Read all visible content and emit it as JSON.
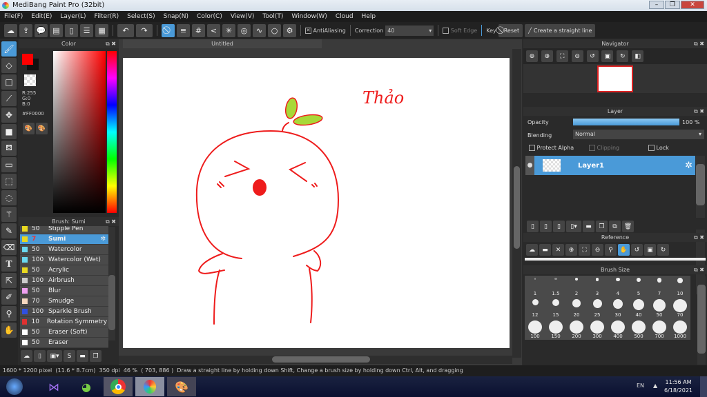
{
  "window": {
    "title": "MediBang Paint Pro (32bit)"
  },
  "menu": [
    "File(F)",
    "Edit(E)",
    "Layer(L)",
    "Filter(R)",
    "Select(S)",
    "Snap(N)",
    "Color(C)",
    "View(V)",
    "Tool(T)",
    "Window(W)",
    "Cloud",
    "Help"
  ],
  "toolbar": {
    "antialiasing": "AntiAliasing",
    "correction_label": "Correction",
    "correction_value": "40",
    "soft_edge": "Soft Edge",
    "key": "Key",
    "reset": "Reset",
    "straight_line": "Create a straight line"
  },
  "color_panel": {
    "title": "Color",
    "r": "R:255",
    "g": "G:0",
    "b": "B:0",
    "hex": "#FF0000",
    "primary": "#FF0000",
    "secondary": "#111111"
  },
  "brush_panel": {
    "title": "Brush: Sumi",
    "items": [
      {
        "size": "50",
        "name": "Stipple Pen",
        "color": "#e8d820"
      },
      {
        "size": "7",
        "name": "Sumi",
        "color": "#e8d820",
        "active": true
      },
      {
        "size": "50",
        "name": "Watercolor",
        "color": "#6ad8f0"
      },
      {
        "size": "100",
        "name": "Watercolor (Wet)",
        "color": "#6ad8f0"
      },
      {
        "size": "50",
        "name": "Acrylic",
        "color": "#e8d820"
      },
      {
        "size": "100",
        "name": "Airbrush",
        "color": "#cccccc"
      },
      {
        "size": "50",
        "name": "Blur",
        "color": "#f0a0f0"
      },
      {
        "size": "70",
        "name": "Smudge",
        "color": "#f5d8c0"
      },
      {
        "size": "100",
        "name": "Sparkle Brush",
        "color": "#3050e0"
      },
      {
        "size": "10",
        "name": "Rotation Symmetry P",
        "color": "#e03030"
      },
      {
        "size": "50",
        "name": "Eraser (Soft)",
        "color": "#ffffff"
      },
      {
        "size": "50",
        "name": "Eraser",
        "color": "#ffffff"
      }
    ]
  },
  "canvas": {
    "tab": "Untitled",
    "signature": "Thảo",
    "stroke_color": "#ee1c1c",
    "leaf_color": "#a8d838"
  },
  "navigator": {
    "title": "Navigator"
  },
  "layer_panel": {
    "title": "Layer",
    "opacity_label": "Opacity",
    "opacity_value": "100 %",
    "opacity": 100,
    "blending_label": "Blending",
    "blending_value": "Normal",
    "protect_alpha": "Protect Alpha",
    "clipping": "Clipping",
    "lock": "Lock",
    "layers": [
      {
        "name": "Layer1"
      }
    ]
  },
  "reference": {
    "title": "Reference"
  },
  "brush_size": {
    "title": "Brush Size",
    "sizes": [
      "1",
      "1.5",
      "2",
      "3",
      "4",
      "5",
      "7",
      "10",
      "12",
      "15",
      "20",
      "25",
      "30",
      "40",
      "50",
      "70",
      "100",
      "150",
      "200",
      "300",
      "400",
      "500",
      "700",
      "1000"
    ]
  },
  "status": {
    "size": "1600 * 1200 pixel",
    "cm": "(11.6 * 8.7cm)",
    "dpi": "350 dpi",
    "zoom": "46 %",
    "coords": "( 703, 886 )",
    "hint": "Draw a straight line by holding down Shift, Change a brush size by holding down Ctrl, Alt, and dragging"
  },
  "taskbar": {
    "lang": "EN",
    "time": "11:56 AM",
    "date": "6/18/2021"
  }
}
